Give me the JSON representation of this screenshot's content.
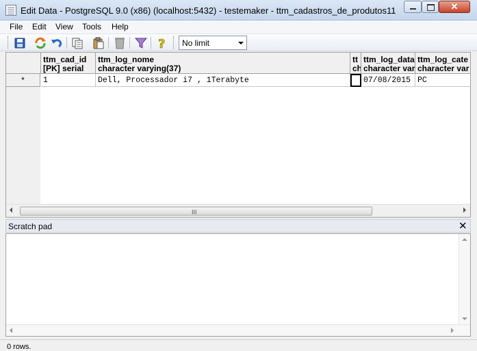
{
  "window": {
    "title": "Edit Data - PostgreSQL 9.0 (x86) (localhost:5432) - testemaker - ttm_cadastros_de_produtos11"
  },
  "menu": [
    "File",
    "Edit",
    "View",
    "Tools",
    "Help"
  ],
  "toolbar": {
    "buttons": [
      "save-icon",
      "refresh-icon",
      "undo-icon",
      "copy-icon",
      "paste-icon",
      "delete-icon",
      "filter-icon",
      "help-icon"
    ],
    "limit": "No limit"
  },
  "grid": {
    "columns": [
      {
        "name": "ttm_cad_id",
        "type": "[PK] serial"
      },
      {
        "name": "ttm_log_nome",
        "type": "character varying(37)"
      },
      {
        "name": "tt",
        "type": "ch"
      },
      {
        "name": "ttm_log_data",
        "type": "character var"
      },
      {
        "name": "ttm_log_cate",
        "type": "character var"
      }
    ],
    "rows": [
      {
        "marker": "*",
        "cells": [
          "1",
          "Dell, Processador i7 , 1Terabyte",
          "",
          "07/08/2015",
          "PC"
        ]
      }
    ],
    "hscroll_grip": "III"
  },
  "scratch_pad": {
    "title": "Scratch pad",
    "content": ""
  },
  "status": {
    "text": "0 rows."
  }
}
